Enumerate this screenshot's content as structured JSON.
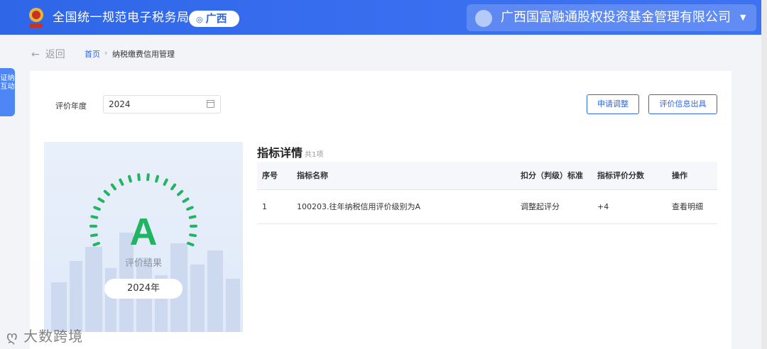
{
  "header": {
    "site_title": "全国统一规范电子税务局",
    "region": "广西",
    "company": "广西国富融通股权投资基金管理有限公司"
  },
  "breadcrumb": {
    "back_label": "返回",
    "home": "首页",
    "separator": "›",
    "current": "纳税缴费信用管理"
  },
  "side_tab": {
    "label": "证纳互动"
  },
  "filters": {
    "year_label": "评价年度",
    "year_value": "2024"
  },
  "actions": {
    "apply_adjust": "申请调整",
    "issue_report": "评价信息出具"
  },
  "result": {
    "grade": "A",
    "caption": "评价结果",
    "year": "2024年"
  },
  "indicators": {
    "title": "指标详情",
    "count": "共1项",
    "columns": [
      "序号",
      "指标名称",
      "扣分（判级）标准",
      "指标评价分数",
      "操作"
    ],
    "rows": [
      {
        "no": "1",
        "name": "100203.往年纳税信用评价级别为A",
        "standard": "调整起评分",
        "score": "+4",
        "action": "查看明细"
      }
    ]
  },
  "watermark": "大数跨境",
  "colors": {
    "brand": "#2f66e8",
    "grade": "#23b463"
  }
}
